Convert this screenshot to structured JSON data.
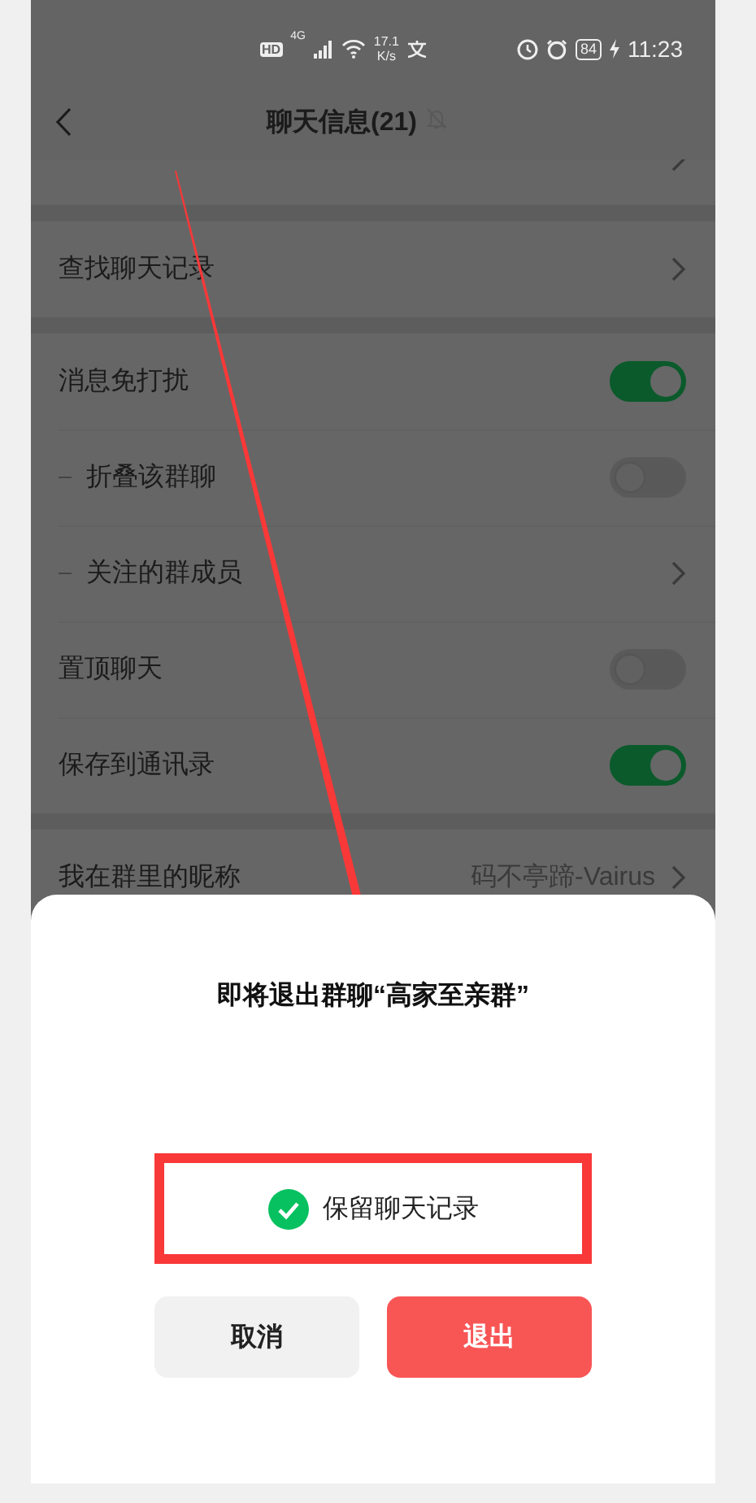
{
  "status_bar": {
    "hd": "HD",
    "network": "4G",
    "speed_value": "17.1",
    "speed_unit": "K/s",
    "battery": "84",
    "time": "11:23"
  },
  "header": {
    "title": "聊天信息(21)",
    "muted": true
  },
  "rows": [
    {
      "kind": "link",
      "label": "查找聊天记录"
    },
    {
      "kind": "toggle",
      "label": "消息免打扰",
      "on": true,
      "children": [
        {
          "kind": "toggle",
          "label": "折叠该群聊",
          "on": false
        },
        {
          "kind": "link",
          "label": "关注的群成员"
        }
      ]
    },
    {
      "kind": "toggle",
      "label": "置顶聊天",
      "on": false
    },
    {
      "kind": "toggle",
      "label": "保存到通讯录",
      "on": true
    },
    {
      "kind": "value",
      "label": "我在群里的昵称",
      "value": "码不亭蹄-Vairus"
    }
  ],
  "dialog": {
    "title": "即将退出群聊“高家至亲群”",
    "keep_history": {
      "label": "保留聊天记录",
      "checked": true,
      "highlighted": true
    },
    "buttons": [
      {
        "kind": "cancel",
        "label": "取消"
      },
      {
        "kind": "danger",
        "label": "退出"
      }
    ]
  },
  "annotation": {
    "arrow": true
  }
}
